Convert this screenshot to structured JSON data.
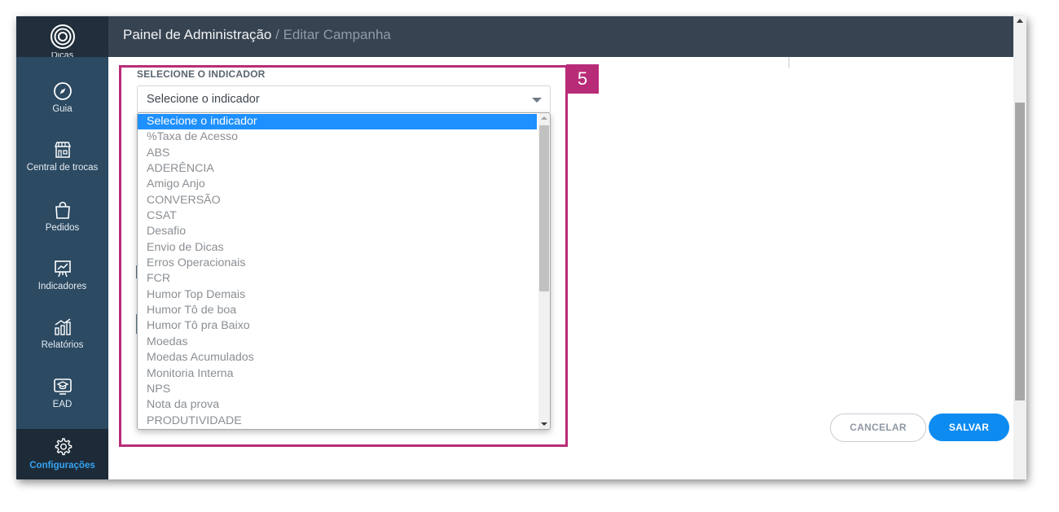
{
  "header": {
    "title": "Painel de Administração",
    "separator": " / ",
    "breadcrumb": "Editar Campanha"
  },
  "sidebar": {
    "partial_label": "Dicas",
    "items": [
      {
        "label": "Guia",
        "icon": "compass-icon"
      },
      {
        "label": "Central de trocas",
        "icon": "storefront-icon"
      },
      {
        "label": "Pedidos",
        "icon": "shopping-bag-icon"
      },
      {
        "label": "Indicadores",
        "icon": "presentation-chart-icon"
      },
      {
        "label": "Relatórios",
        "icon": "bar-chart-icon"
      },
      {
        "label": "EAD",
        "icon": "graduation-cap-icon"
      },
      {
        "label": "Configurações",
        "icon": "gear-icon",
        "active": true
      }
    ]
  },
  "form": {
    "indicator_label": "SELECIONE O INDICADOR",
    "indicator_select_value": "Selecione o indicador",
    "options": [
      "Selecione o indicador",
      "%Taxa de Acesso",
      "ABS",
      "ADERÊNCIA",
      "Amigo Anjo",
      "CONVERSÃO",
      "CSAT",
      "Desafio",
      "Envio de Dicas",
      "Erros Operacionais",
      "FCR",
      "Humor Top Demais",
      "Humor Tô de boa",
      "Humor Tô pra Baixo",
      "Moedas",
      "Moedas Acumulados",
      "Monitoria Interna",
      "NPS",
      "Nota da prova",
      "PRODUTIVIDADE"
    ],
    "selected_option_index": 0
  },
  "annotation": {
    "step_number": "5",
    "color": "#b82c77"
  },
  "actions": {
    "cancel_label": "CANCELAR",
    "save_label": "SALVAR"
  },
  "colors": {
    "sidebar": "#2c4a62",
    "topbar": "#364350",
    "accent": "#0d8bf0",
    "active_nav_text": "#35a4f4"
  }
}
